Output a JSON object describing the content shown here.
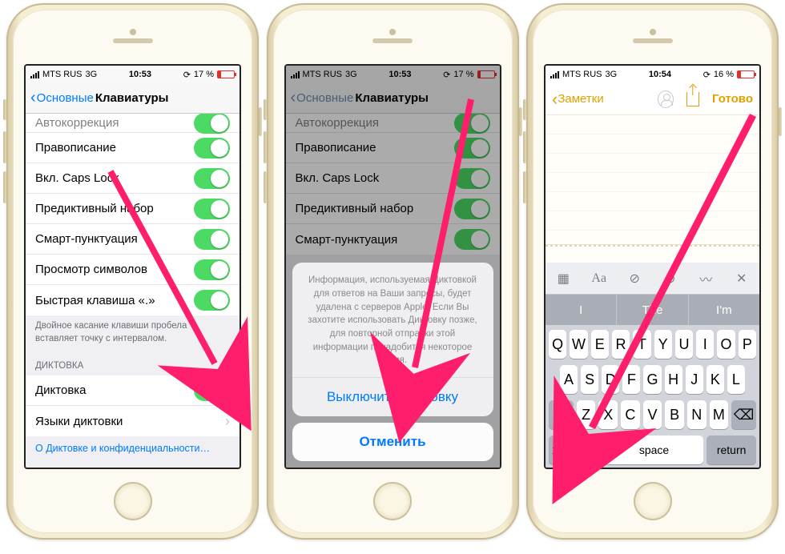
{
  "phone1": {
    "status": {
      "carrier": "MTS RUS",
      "network": "3G",
      "time": "10:53",
      "battery": "17 %"
    },
    "nav": {
      "back": "Основные",
      "title": "Клавиатуры"
    },
    "rows": {
      "r0": "Автокоррекция",
      "r1": "Правописание",
      "r2": "Вкл. Caps Lock",
      "r3": "Предиктивный набор",
      "r4": "Смарт-пунктуация",
      "r5": "Просмотр символов",
      "r6": "Быстрая клавиша «.»"
    },
    "footer": "Двойное касание клавиши пробела вставляет точку с интервалом.",
    "sectionHeader": "ДИКТОВКА",
    "dictRow": "Диктовка",
    "langRow": "Языки диктовки",
    "link": "О Диктовке и конфиденциальности…"
  },
  "phone2": {
    "status": {
      "carrier": "MTS RUS",
      "network": "3G",
      "time": "10:53",
      "battery": "17 %"
    },
    "nav": {
      "back": "Основные",
      "title": "Клавиатуры"
    },
    "rows": {
      "r0": "Автокоррекция",
      "r1": "Правописание",
      "r2": "Вкл. Caps Lock",
      "r3": "Предиктивный набор",
      "r4": "Смарт-пунктуация"
    },
    "sheet": {
      "msg": "Информация, используемая Диктовкой для ответов на Ваши запросы, будет удалена с серверов Apple. Если Вы захотите использовать Диктовку позже, для повторной отправки этой информации понадобится некоторое время.",
      "action": "Выключить Диктовку",
      "cancel": "Отменить"
    }
  },
  "phone3": {
    "status": {
      "carrier": "MTS RUS",
      "network": "3G",
      "time": "10:54",
      "battery": "16 %"
    },
    "nav": {
      "back": "Заметки",
      "done": "Готово"
    },
    "suggestions": [
      "I",
      "The",
      "I'm"
    ],
    "kbRow1": [
      "Q",
      "W",
      "E",
      "R",
      "T",
      "Y",
      "U",
      "I",
      "O",
      "P"
    ],
    "kbRow2": [
      "A",
      "S",
      "D",
      "F",
      "G",
      "H",
      "J",
      "K",
      "L"
    ],
    "kbRow3": [
      "Z",
      "X",
      "C",
      "V",
      "B",
      "N",
      "M"
    ],
    "kbBottom": {
      "num": "123",
      "space": "space",
      "ret": "return"
    }
  }
}
